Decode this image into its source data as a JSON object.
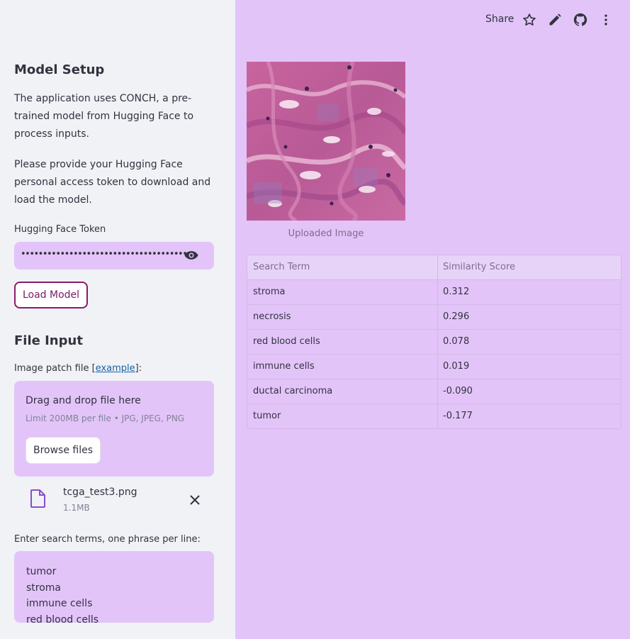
{
  "sidebar": {
    "model_setup_heading": "Model Setup",
    "model_setup_para1": "The application uses CONCH, a pre-trained model from Hugging Face to process inputs.",
    "model_setup_para2": "Please provide your Hugging Face personal access token to download and load the model.",
    "token_label": "Hugging Face Token",
    "token_value": "••••••••••••••••••••••••••••••••••••••",
    "load_model_label": "Load Model",
    "file_input_heading": "File Input",
    "image_patch_label_prefix": "Image patch file [",
    "image_patch_label_link": "example",
    "image_patch_label_suffix": "]:",
    "drop_title": "Drag and drop file here",
    "drop_limit": "Limit 200MB per file • JPG, JPEG, PNG",
    "browse_label": "Browse files",
    "file_name": "tcga_test3.png",
    "file_size": "1.1MB",
    "search_terms_label": "Enter search terms, one phrase per line:",
    "search_terms_lines": [
      "tumor",
      "stroma",
      "immune cells",
      "red blood cells"
    ]
  },
  "topbar": {
    "share_label": "Share",
    "icons": [
      "star-icon",
      "edit-icon",
      "github-icon",
      "more-vertical-icon"
    ]
  },
  "main": {
    "image_caption": "Uploaded Image",
    "table": {
      "headers": [
        "Search Term",
        "Similarity Score"
      ],
      "rows": [
        [
          "stroma",
          "0.312"
        ],
        [
          "necrosis",
          "0.296"
        ],
        [
          "red blood cells",
          "0.078"
        ],
        [
          "immune cells",
          "0.019"
        ],
        [
          "ductal carcinoma",
          "-0.090"
        ],
        [
          "tumor",
          "-0.177"
        ]
      ]
    }
  },
  "colors": {
    "accent": "#e3c4f9",
    "sidebar_bg": "#f0f2f6",
    "button_border": "#8a1a6e"
  }
}
